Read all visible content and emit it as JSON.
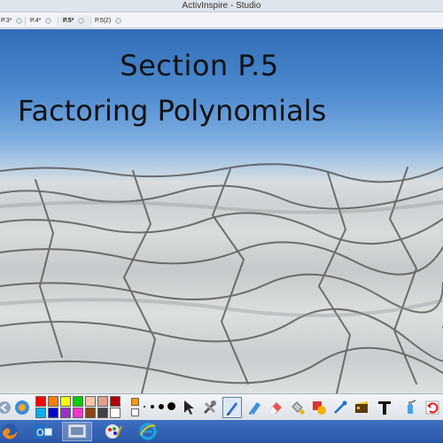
{
  "window": {
    "title": "ActivInspire - Studio"
  },
  "tabs": [
    {
      "label": "P.3*"
    },
    {
      "label": "P.4*"
    },
    {
      "label": "P.5*",
      "active": true
    },
    {
      "label": "P.5(2)"
    }
  ],
  "slide": {
    "title": "Section P.5",
    "subtitle": "Factoring Polynomials"
  },
  "toolbar": {
    "palette_colors": [
      "#ff0000",
      "#ff8000",
      "#ffff00",
      "#00cc00",
      "#f5c6a5",
      "#e0a090",
      "#b00000",
      "#00b0f0",
      "#0000cc",
      "#9933cc",
      "#ff33cc",
      "#8b4513",
      "#404040",
      "#ffffff"
    ],
    "extra_swatch": "#ff9900",
    "tools": [
      "select-icon",
      "tools-icon",
      "pen-icon",
      "highlighter-icon",
      "eraser-icon",
      "fill-icon",
      "shape-icon",
      "connector-icon",
      "clip-icon",
      "text-icon",
      "spray-icon",
      "undo-icon"
    ]
  },
  "taskbar": {
    "apps": [
      "firefox-icon",
      "outlook-icon",
      "activinspire-icon",
      "paint-icon",
      "internet-explorer-icon"
    ]
  }
}
